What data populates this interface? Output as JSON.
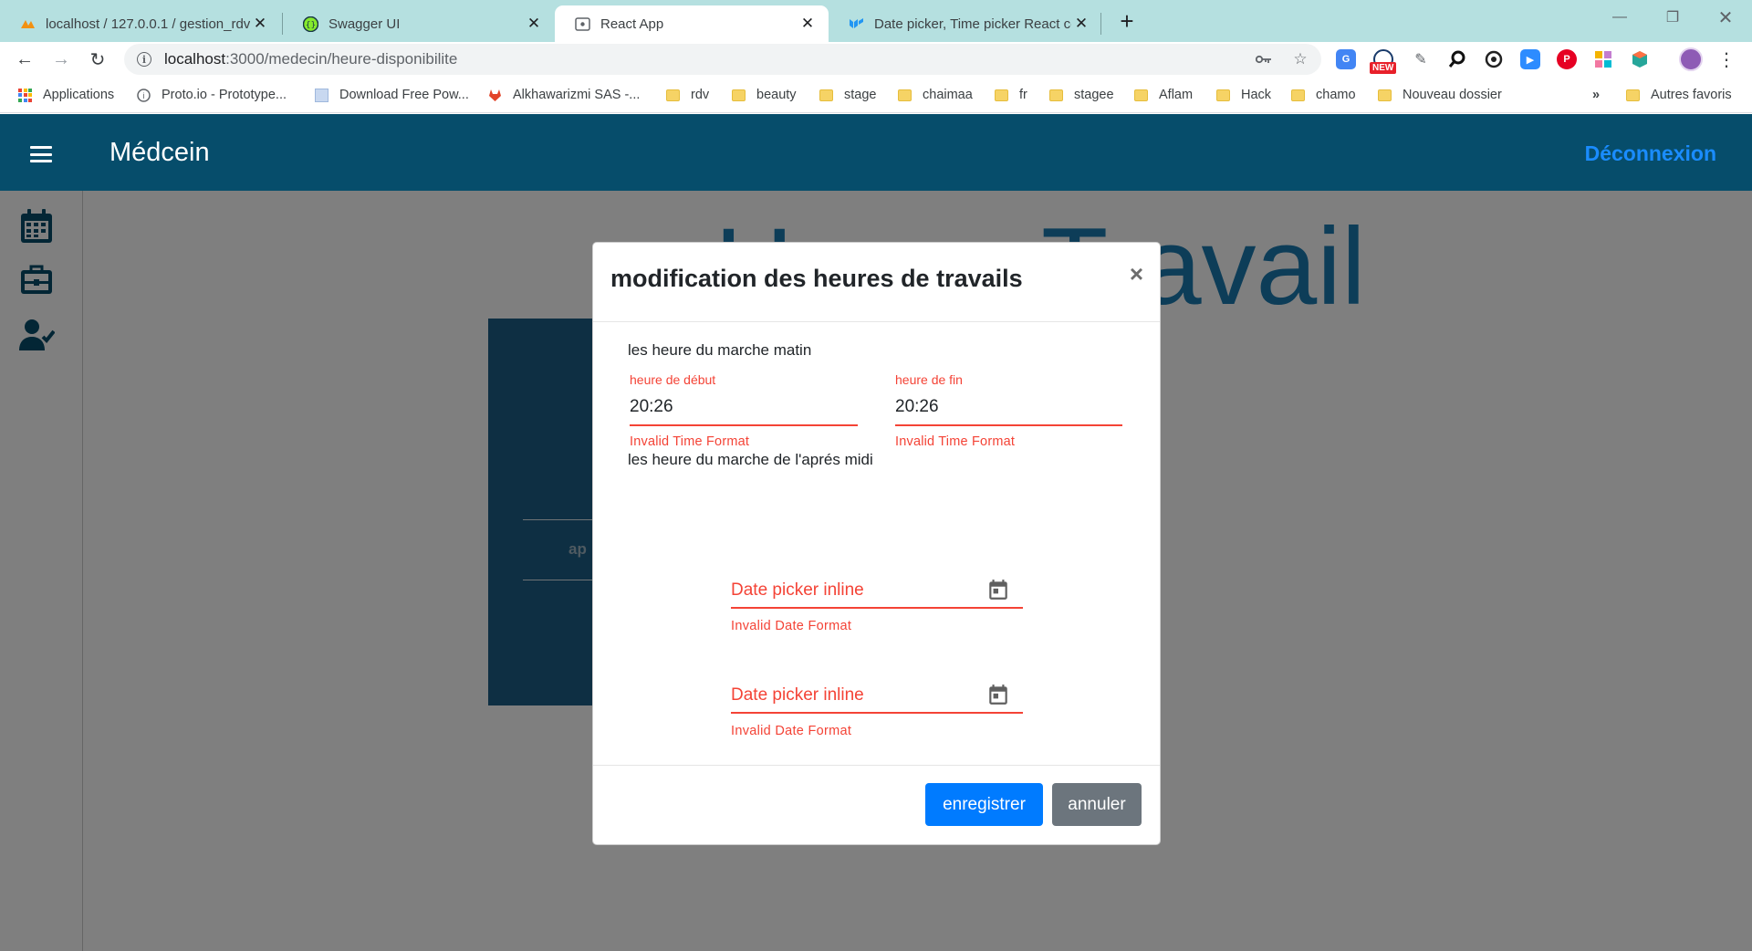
{
  "browser": {
    "tabs": [
      {
        "title": "localhost / 127.0.0.1 / gestion_rdv",
        "active": false
      },
      {
        "title": "Swagger UI",
        "active": false
      },
      {
        "title": "React App",
        "active": true
      },
      {
        "title": "Date picker, Time picker React co",
        "active": false
      }
    ],
    "url_host": "localhost",
    "url_path": ":3000/medecin/heure-disponibilite",
    "bookmarks": [
      "Applications",
      "Proto.io - Prototype...",
      "Download Free Pow...",
      "Alkhawarizmi SAS -...",
      "rdv",
      "beauty",
      "stage",
      "chaimaa",
      "fr",
      "stagee",
      "Aflam",
      "Hack",
      "chamo",
      "Nouveau dossier"
    ],
    "more_bookmarks": "»",
    "other_bookmarks": "Autres favoris",
    "extension_badge": "NEW"
  },
  "app": {
    "title": "Médcein",
    "logout": "Déconnexion",
    "background_heading": "Heure Travail",
    "background_card_text": "ap"
  },
  "modal": {
    "title": "modification des heures de travails",
    "close": "×",
    "morning_label": "les heure du marche matin",
    "start": {
      "label": "heure de début",
      "value": "20:26",
      "error": "Invalid Time Format"
    },
    "end": {
      "label": "heure de fin",
      "value": "20:26",
      "error": "Invalid Time Format"
    },
    "afternoon_label": "les heure du marche de l'aprés midi",
    "date_pickers": [
      {
        "placeholder": "Date picker inline",
        "error": "Invalid Date Format"
      },
      {
        "placeholder": "Date picker inline",
        "error": "Invalid Date Format"
      }
    ],
    "save": "enregistrer",
    "cancel": "annuler"
  },
  "colors": {
    "appbar": "#064d6b",
    "primary": "#007bff",
    "secondary": "#6c757d",
    "error": "#f44336",
    "logout": "#1a8cff"
  }
}
